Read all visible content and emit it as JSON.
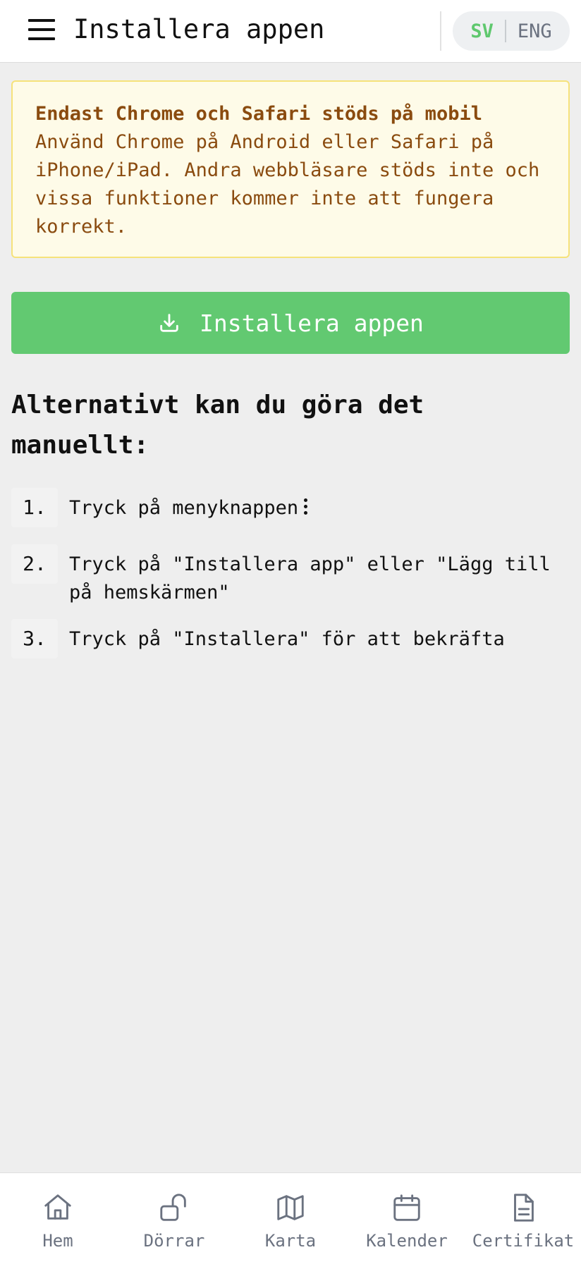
{
  "header": {
    "title": "Installera appen",
    "lang_sv": "SV",
    "lang_en": "ENG"
  },
  "warning": {
    "title": "Endast Chrome och Safari stöds på mobil",
    "text": "Använd Chrome på Android eller Safari på iPhone/iPad. Andra webbläsare stöds inte och vissa funktioner kommer inte att fungera korrekt."
  },
  "install_button": {
    "label": "Installera appen"
  },
  "manual": {
    "heading": "Alternativt kan du göra det manuellt:",
    "steps": [
      {
        "num": "1.",
        "text": "Tryck på menyknappen"
      },
      {
        "num": "2.",
        "text": "Tryck på \"Installera app\" eller \"Lägg till på hemskärmen\""
      },
      {
        "num": "3.",
        "text": "Tryck på \"Installera\" för att bekräfta"
      }
    ]
  },
  "bottom_nav": {
    "items": [
      {
        "label": "Hem",
        "icon": "home-icon"
      },
      {
        "label": "Dörrar",
        "icon": "unlock-icon"
      },
      {
        "label": "Karta",
        "icon": "map-icon"
      },
      {
        "label": "Kalender",
        "icon": "calendar-icon"
      },
      {
        "label": "Certifikat",
        "icon": "document-icon"
      }
    ]
  },
  "colors": {
    "accent_green": "#62c971",
    "warning_bg": "#fefbe8",
    "warning_border": "#f6e27a",
    "warning_text": "#8a4b0f",
    "nav_gray": "#6b7280"
  }
}
